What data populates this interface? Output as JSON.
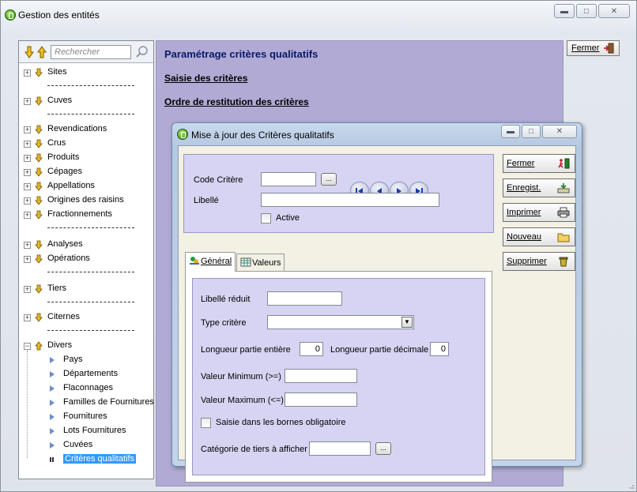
{
  "window": {
    "title": "Gestion des entités"
  },
  "tree": {
    "search_placeholder": "Rechercher",
    "groups1": [
      {
        "label": "Sites"
      },
      {
        "label": "Cuves"
      }
    ],
    "groups2": [
      {
        "label": "Revendications"
      },
      {
        "label": "Crus"
      },
      {
        "label": "Produits"
      },
      {
        "label": "Cépages"
      },
      {
        "label": "Appellations"
      },
      {
        "label": "Origines des raisins"
      },
      {
        "label": "Fractionnements"
      }
    ],
    "groups3": [
      {
        "label": "Analyses"
      },
      {
        "label": "Opérations"
      }
    ],
    "groups4": [
      {
        "label": "Tiers"
      },
      {
        "label": "Citernes"
      }
    ],
    "divers": {
      "label": "Divers",
      "children": [
        {
          "label": "Pays"
        },
        {
          "label": "Départements"
        },
        {
          "label": "Flaconnages"
        },
        {
          "label": "Familles de Fournitures"
        },
        {
          "label": "Fournitures"
        },
        {
          "label": "Lots Fournitures"
        },
        {
          "label": "Cuvées"
        },
        {
          "label": "Critères qualitatifs"
        }
      ],
      "selected": "Critères qualitatifs"
    }
  },
  "main": {
    "title": "Paramétrage critères qualitatifs",
    "link_saisie": "Saisie des critères",
    "link_ordre": "Ordre de restitution des critères",
    "fermer": "Fermer"
  },
  "dialog": {
    "title": "Mise à jour des Critères qualitatifs",
    "code_label": "Code Critère",
    "code_value": "",
    "libelle_label": "Libellé",
    "libelle_value": "",
    "active_label": "Active",
    "ellipsis": "...",
    "buttons": {
      "fermer": "Fermer",
      "enregist": "Enregist.",
      "imprimer": "Imprimer",
      "nouveau": "Nouveau",
      "supprimer": "Supprimer"
    },
    "tabs": {
      "general": "Général",
      "valeurs": "Valeurs"
    },
    "general": {
      "libelle_reduit_label": "Libellé réduit",
      "type_critere_label": "Type critère",
      "longueur_entiere_label": "Longueur partie entière",
      "longueur_entiere_value": "0",
      "longueur_decimale_label": "Longueur partie décimale",
      "longueur_decimale_value": "0",
      "valeur_min_label": "Valeur Minimum (>=)",
      "valeur_max_label": "Valeur Maximum (<=)",
      "saisie_bornes_label": "Saisie dans les bornes obligatoire",
      "categorie_label": "Catégorie de tiers à afficher"
    }
  },
  "colors": {
    "main_panel_bg": "#b0aad4",
    "form_bg": "#d6d4f2",
    "selection": "#3399ff",
    "title_color": "#0a1a66"
  }
}
